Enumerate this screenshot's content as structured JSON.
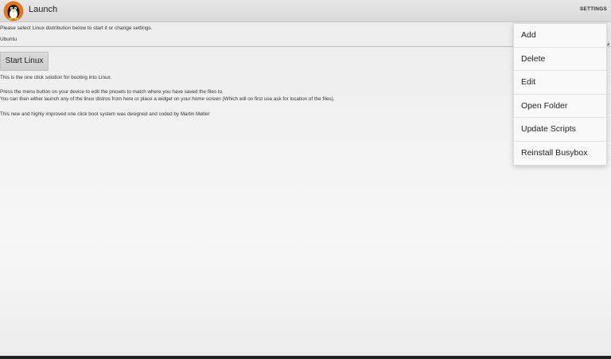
{
  "app": {
    "title": "Launch",
    "icon": "tux-penguin-icon",
    "settings_label": "SETTINGS"
  },
  "main": {
    "prompt": "Please select Linux distribution below to start it or change settings.",
    "distribution": {
      "selected": "Ubuntu"
    },
    "start_button": "Start Linux",
    "lines": [
      "This is the one click solution for booting into Linux.",
      "Press the menu button on your device to edit the presets to match where you have saved the files to.",
      "You can then either launch any of the linux distros from here or place a widget on your home screen (Which will on first use ask for location of the files).",
      "This new and highly improved one click boot system was designed and coded by Martin Møller"
    ]
  },
  "menu": {
    "items": [
      {
        "label": "Add"
      },
      {
        "label": "Delete"
      },
      {
        "label": "Edit"
      },
      {
        "label": "Open Folder"
      },
      {
        "label": "Update Scripts"
      },
      {
        "label": "Reinstall Busybox"
      }
    ]
  },
  "colors": {
    "action_bar": "#dcdcdc",
    "background": "#f3f3f3",
    "menu_background": "#f9f9f9",
    "text": "#333333"
  }
}
